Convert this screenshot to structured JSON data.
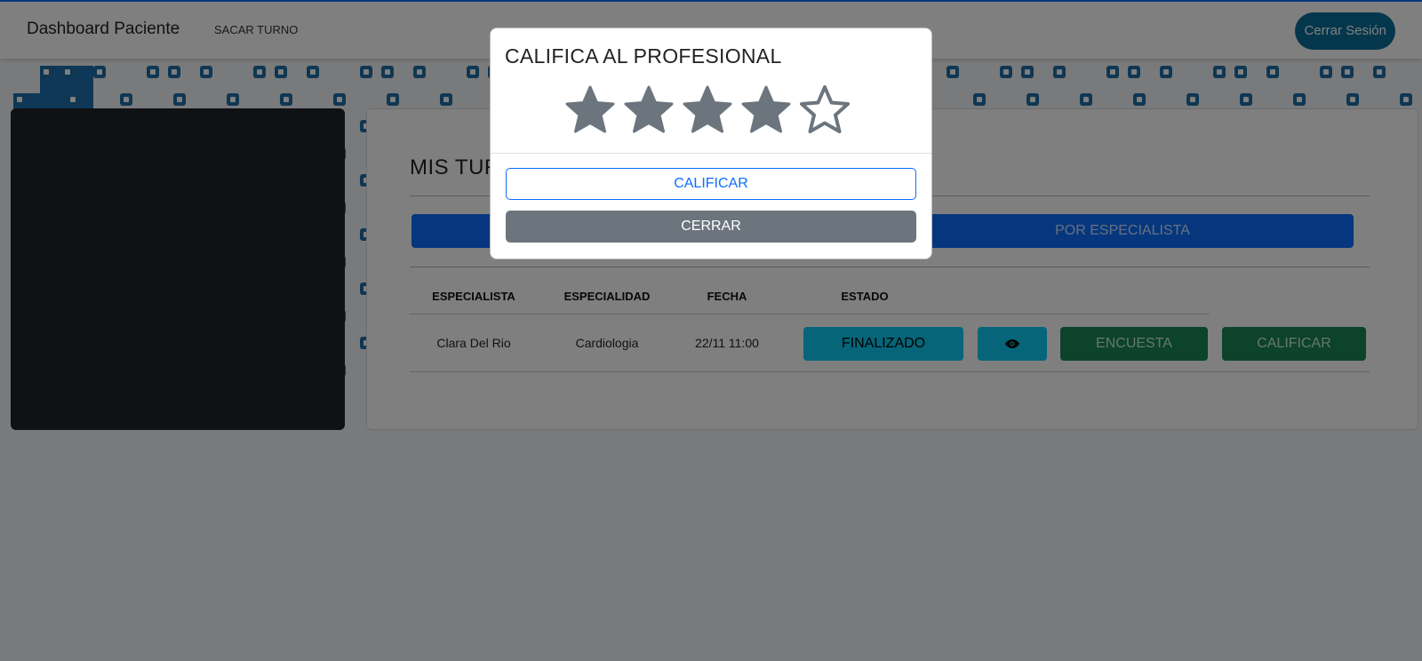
{
  "navbar": {
    "brand": "Dashboard Paciente",
    "link_sacar_turno": "SACAR TURNO",
    "logout_label": "Cerrar Sesión"
  },
  "main": {
    "title": "MIS TURNOS",
    "filters": {
      "left_label": "",
      "right_label": "POR ESPECIALISTA"
    },
    "table": {
      "headers": [
        "ESPECIALISTA",
        "ESPECIALIDAD",
        "FECHA",
        "ESTADO"
      ],
      "rows": [
        {
          "especialista": "Clara Del Rio",
          "especialidad": "Cardiologia",
          "fecha": "22/11 11:00",
          "estado": "FINALIZADO",
          "view_icon": "eye-icon",
          "encuesta_label": "ENCUESTA",
          "calificar_label": "CALIFICAR"
        }
      ]
    }
  },
  "modal": {
    "title": "CALIFICA AL PROFESIONAL",
    "rating": 4,
    "max_rating": 5,
    "calificar_label": "CALIFICAR",
    "cerrar_label": "CERRAR"
  },
  "colors": {
    "primary": "#0d6efd",
    "info": "#0dcaf0",
    "success": "#198754",
    "secondary": "#6c757d",
    "logout": "#0b6e99",
    "star": "#6c757d"
  }
}
